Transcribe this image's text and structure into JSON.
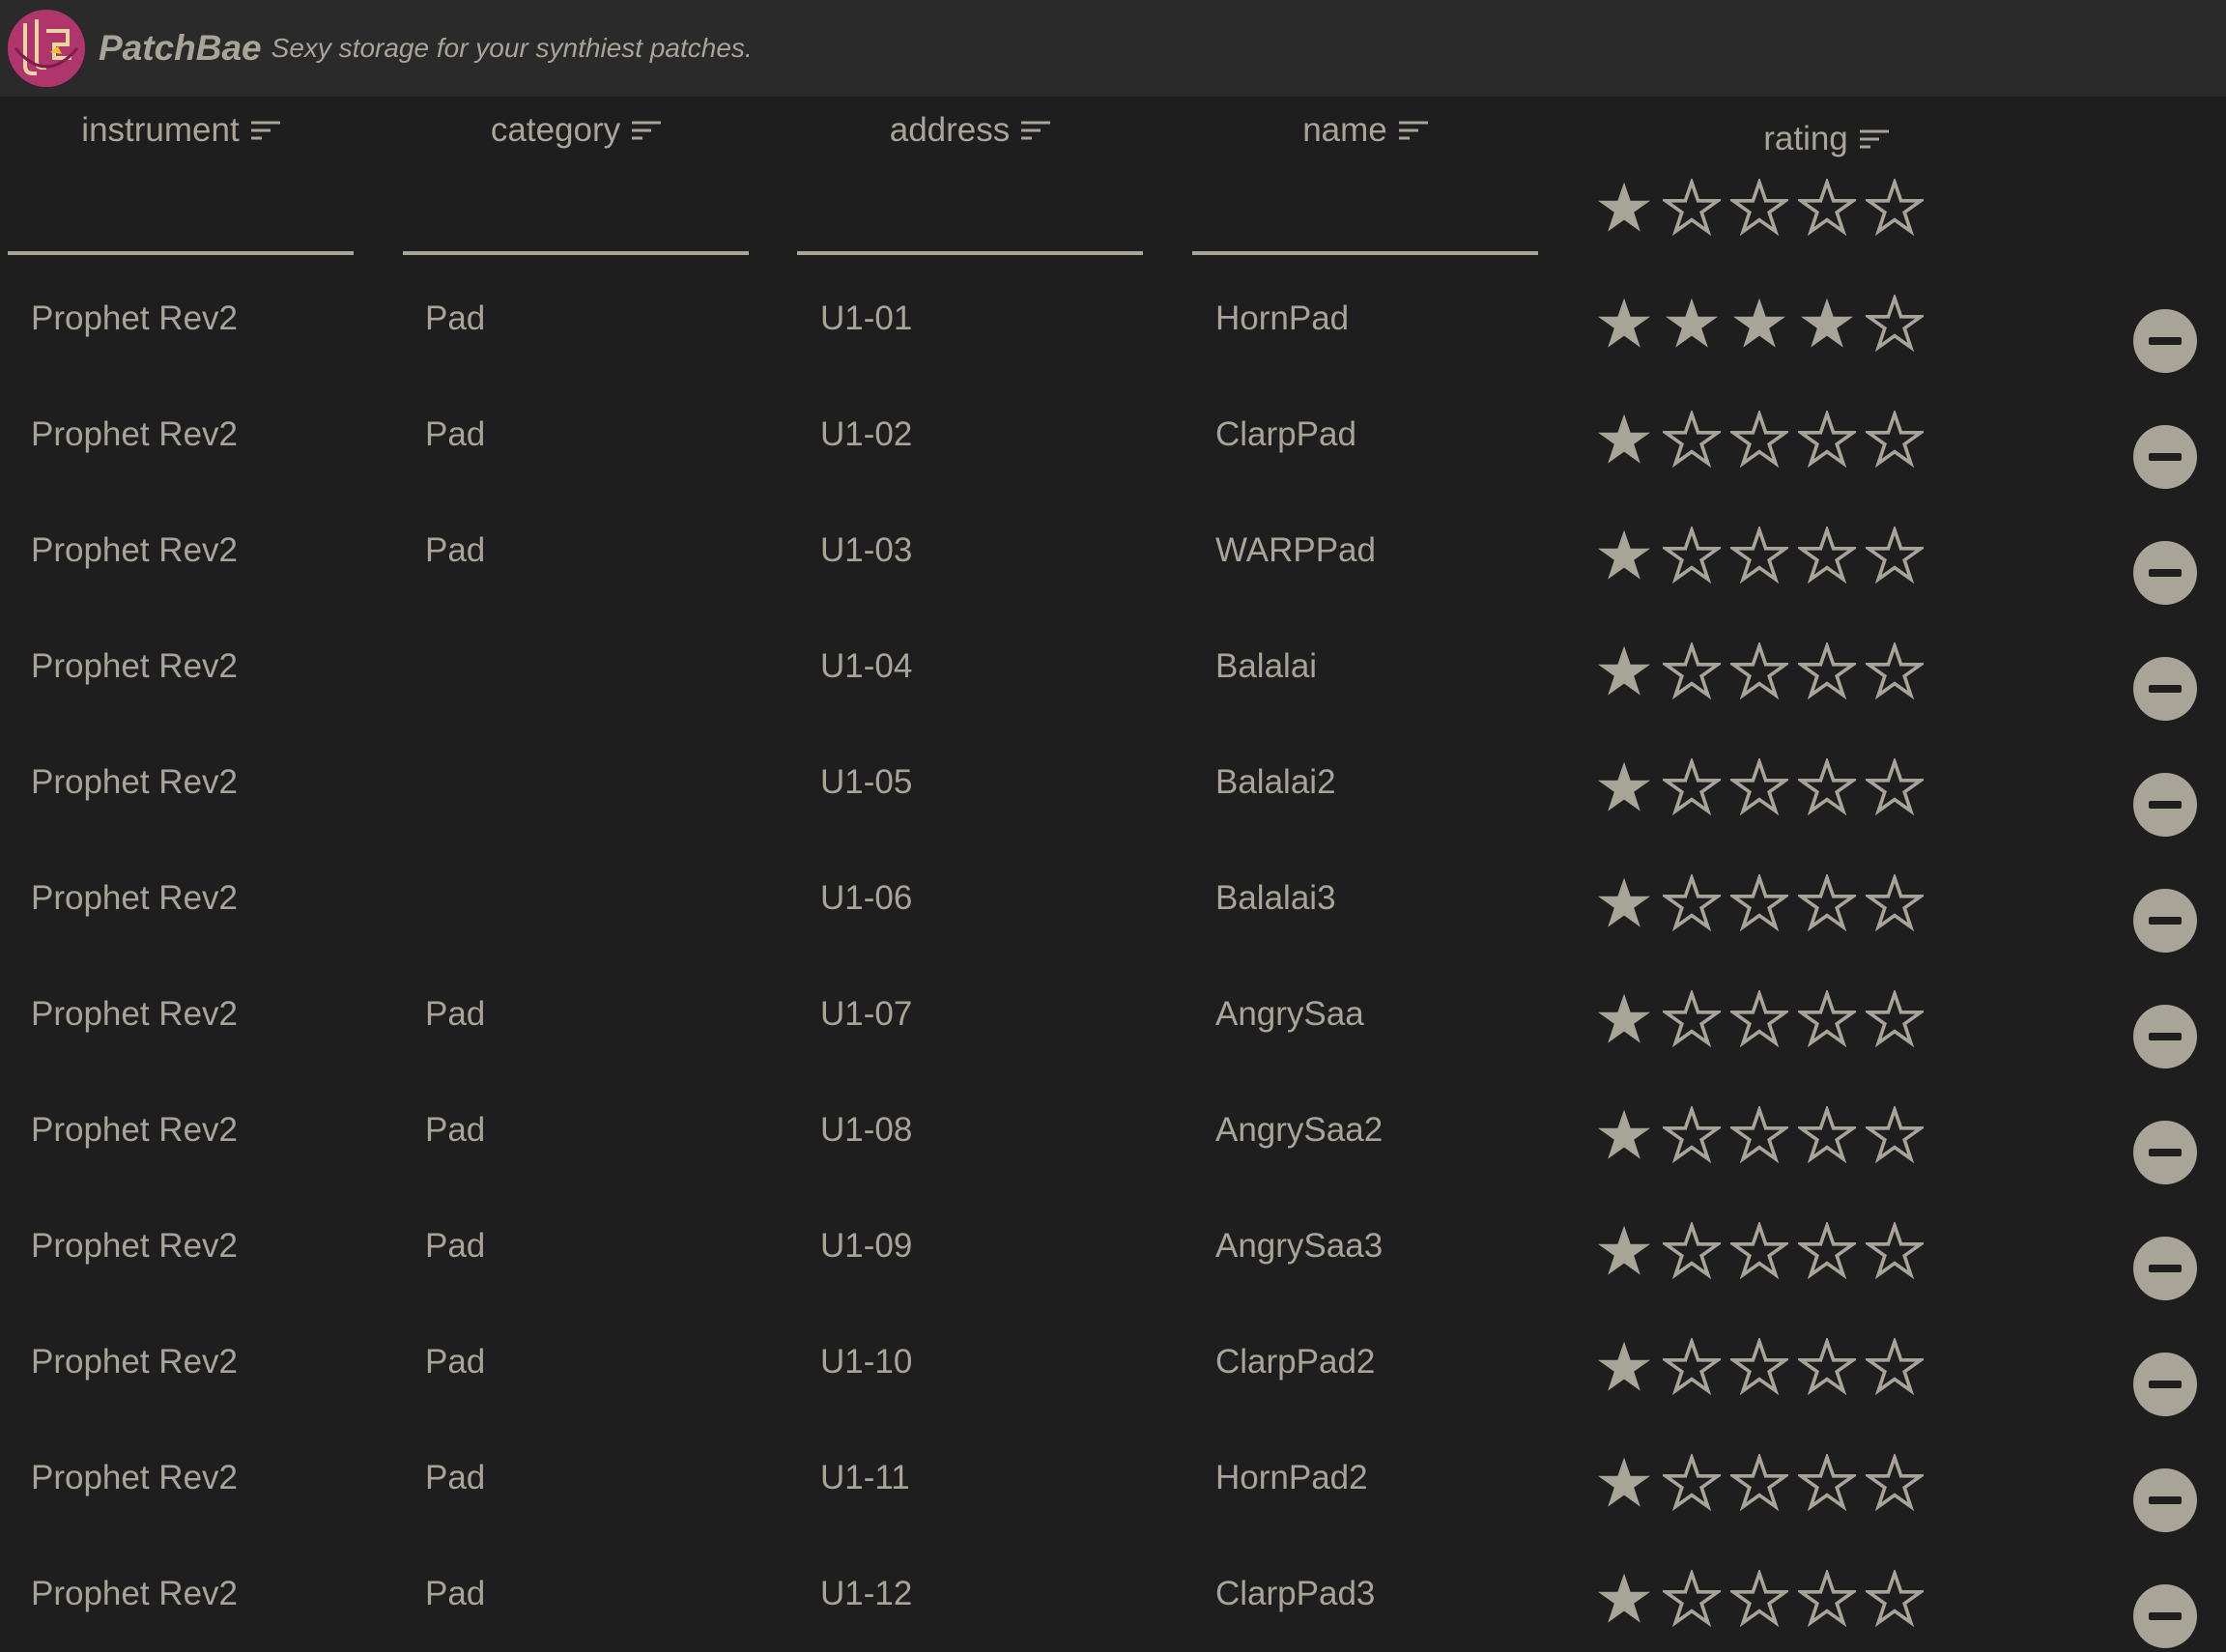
{
  "app": {
    "title": "PatchBae",
    "tagline": "Sexy storage for your synthiest patches."
  },
  "colors": {
    "background": "#1e1e1e",
    "header": "#2a2a2a",
    "text": "#a8a498",
    "logo": "#b0356d"
  },
  "columns": [
    {
      "label": "instrument"
    },
    {
      "label": "category"
    },
    {
      "label": "address"
    },
    {
      "label": "name"
    },
    {
      "label": "rating"
    }
  ],
  "filter_rating": 1,
  "rows": [
    {
      "instrument": "Prophet Rev2",
      "category": "Pad",
      "address": "U1-01",
      "name": "HornPad",
      "rating": 4
    },
    {
      "instrument": "Prophet Rev2",
      "category": "Pad",
      "address": "U1-02",
      "name": "ClarpPad",
      "rating": 1
    },
    {
      "instrument": "Prophet Rev2",
      "category": "Pad",
      "address": "U1-03",
      "name": "WARPPad",
      "rating": 1
    },
    {
      "instrument": "Prophet Rev2",
      "category": "",
      "address": "U1-04",
      "name": "Balalai",
      "rating": 1
    },
    {
      "instrument": "Prophet Rev2",
      "category": "",
      "address": "U1-05",
      "name": "Balalai2",
      "rating": 1
    },
    {
      "instrument": "Prophet Rev2",
      "category": "",
      "address": "U1-06",
      "name": "Balalai3",
      "rating": 1
    },
    {
      "instrument": "Prophet Rev2",
      "category": "Pad",
      "address": "U1-07",
      "name": "AngrySaa",
      "rating": 1
    },
    {
      "instrument": "Prophet Rev2",
      "category": "Pad",
      "address": "U1-08",
      "name": "AngrySaa2",
      "rating": 1
    },
    {
      "instrument": "Prophet Rev2",
      "category": "Pad",
      "address": "U1-09",
      "name": "AngrySaa3",
      "rating": 1
    },
    {
      "instrument": "Prophet Rev2",
      "category": "Pad",
      "address": "U1-10",
      "name": "ClarpPad2",
      "rating": 1
    },
    {
      "instrument": "Prophet Rev2",
      "category": "Pad",
      "address": "U1-11",
      "name": "HornPad2",
      "rating": 1
    },
    {
      "instrument": "Prophet Rev2",
      "category": "Pad",
      "address": "U1-12",
      "name": "ClarpPad3",
      "rating": 1
    }
  ]
}
